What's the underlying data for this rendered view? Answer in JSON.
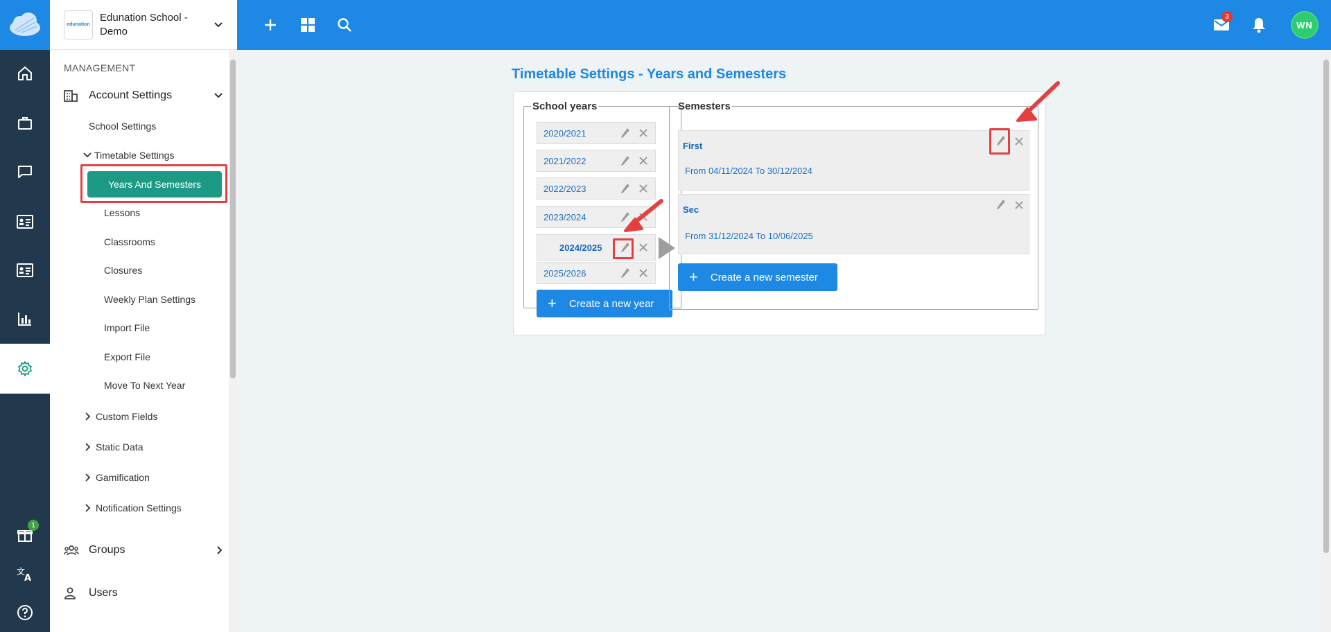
{
  "sidebar": {
    "school_name": "Edunation School - Demo",
    "school_logo_text": "edunation",
    "section_label": "MANAGEMENT",
    "account_settings": "Account Settings",
    "school_settings": "School Settings",
    "timetable_settings": "Timetable Settings",
    "timetable_children": [
      "Years And Semesters",
      "Lessons",
      "Classrooms",
      "Closures",
      "Weekly Plan Settings",
      "Import File",
      "Export File",
      "Move To Next Year"
    ],
    "collapsed_groups": [
      "Custom Fields",
      "Static Data",
      "Gamification",
      "Notification Settings"
    ],
    "groups": "Groups",
    "users": "Users"
  },
  "rail": {
    "gift_badge": "1"
  },
  "header": {
    "mail_badge": "3",
    "avatar_initials": "WN"
  },
  "main": {
    "title": "Timetable Settings - Years and Semesters",
    "school_years_legend": "School years",
    "semesters_legend": "Semesters",
    "years": [
      "2020/2021",
      "2021/2022",
      "2022/2023",
      "2023/2024",
      "2024/2025",
      "2025/2026"
    ],
    "selected_year": "2024/2025",
    "create_year": "Create a new year",
    "create_semester": "Create a new semester",
    "semesters": [
      {
        "name": "First",
        "dates": "From 04/11/2024 To 30/12/2024"
      },
      {
        "name": "Sec",
        "dates": "From 31/12/2024 To 10/06/2025"
      }
    ]
  },
  "colors": {
    "brand_blue": "#1e88e5",
    "active_green": "#1d9a85",
    "highlight_red": "#e34141",
    "rail_dark": "#22394d"
  }
}
